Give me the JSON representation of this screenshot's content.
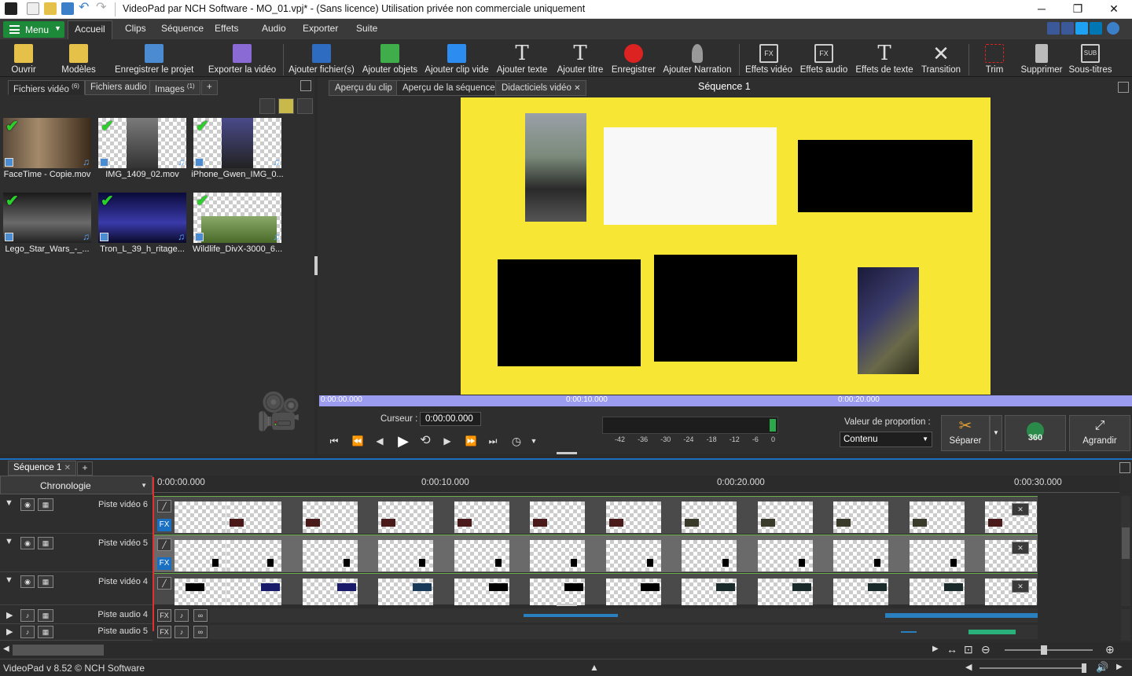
{
  "window": {
    "title": "VideoPad par NCH Software - MO_01.vpj* - (Sans licence) Utilisation privée non commerciale uniquement",
    "controls": [
      "─",
      "❐",
      "✕"
    ]
  },
  "menu": {
    "menu_label": "Menu",
    "tabs": [
      "Accueil",
      "Clips",
      "Séquence",
      "Effets",
      "Audio",
      "Exporter",
      "Suite"
    ],
    "active_tab": "Accueil"
  },
  "toolbar": {
    "buttons": [
      {
        "label": "Ouvrir",
        "icon": "folder-open-icon"
      },
      {
        "label": "Modèles",
        "icon": "templates-icon"
      },
      {
        "label": "Enregistrer le projet",
        "icon": "save-icon"
      },
      {
        "label": "Exporter la vidéo",
        "icon": "export-video-icon"
      },
      {
        "label": "Ajouter fichier(s)",
        "icon": "add-files-icon"
      },
      {
        "label": "Ajouter objets",
        "icon": "add-objects-icon"
      },
      {
        "label": "Ajouter clip vide",
        "icon": "add-blank-clip-icon"
      },
      {
        "label": "Ajouter texte",
        "icon": "add-text-icon"
      },
      {
        "label": "Ajouter titre",
        "icon": "add-title-icon"
      },
      {
        "label": "Enregistrer",
        "icon": "record-icon"
      },
      {
        "label": "Ajouter Narration",
        "icon": "microphone-icon"
      },
      {
        "label": "Effets vidéo",
        "icon": "video-effects-icon"
      },
      {
        "label": "Effets audio",
        "icon": "audio-effects-icon"
      },
      {
        "label": "Effets de texte",
        "icon": "text-effects-icon"
      },
      {
        "label": "Transition",
        "icon": "transition-icon"
      },
      {
        "label": "Trim",
        "icon": "trim-icon"
      },
      {
        "label": "Supprimer",
        "icon": "trash-icon"
      },
      {
        "label": "Sous-titres",
        "icon": "subtitles-icon"
      }
    ]
  },
  "bin": {
    "tabs": [
      {
        "label": "Fichiers vidéo",
        "badge": "(6)"
      },
      {
        "label": "Fichiers audio",
        "badge": ""
      },
      {
        "label": "Images",
        "badge": "(1)"
      }
    ],
    "add_tab": "+",
    "files": [
      {
        "name": "FaceTime - Copie.mov"
      },
      {
        "name": "IMG_1409_02.mov"
      },
      {
        "name": "iPhone_Gwen_IMG_0..."
      },
      {
        "name": "Lego_Star_Wars_-_..."
      },
      {
        "name": "Tron_L_39_h_ritage..."
      },
      {
        "name": "Wildlife_DivX-3000_6..."
      }
    ]
  },
  "preview": {
    "tabs": [
      "Aperçu du clip",
      "Aperçu de la séquence",
      "Didacticiels vidéo"
    ],
    "sequence_title": "Séquence 1",
    "scrub_ticks": [
      "0:00:00.000",
      "0:00:10.000",
      "0:00:20.000"
    ],
    "cursor_label": "Curseur :",
    "cursor_value": "0:00:00.000",
    "meter_ticks": [
      "-42",
      "-36",
      "-30",
      "-24",
      "-18",
      "-12",
      "-6",
      "0"
    ],
    "aspect_label": "Valeur de proportion :",
    "aspect_value": "Contenu",
    "split_label": "Séparer",
    "vr_label": "360",
    "enlarge_label": "Agrandir"
  },
  "sequence": {
    "tab": "Séquence 1",
    "view_select": "Chronologie",
    "ruler_ticks": [
      "0:00:00.000",
      "0:00:10.000",
      "0:00:20.000",
      "0:00:30.000"
    ],
    "video_tracks": [
      "Piste vidéo 6",
      "Piste vidéo 5",
      "Piste vidéo 4"
    ],
    "audio_tracks": [
      "Piste audio 4",
      "Piste audio 5"
    ],
    "fx_label": "FX"
  },
  "status": {
    "version": "VideoPad v 8.52 © NCH Software"
  },
  "colors": {
    "accent_green": "#1d8a3a",
    "canvas_yellow": "#f7e633",
    "scrub_purple": "#9b9bf0",
    "track_green": "#6ab04c",
    "playhead_red": "#e03030"
  }
}
